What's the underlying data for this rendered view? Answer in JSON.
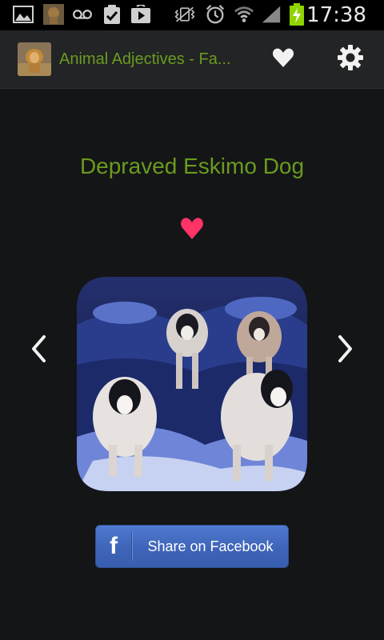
{
  "status_bar": {
    "time": "17:38",
    "icons": [
      "image-icon",
      "animal-thumbnail-icon",
      "voicemail-icon",
      "clipboard-check-icon",
      "play-store-icon",
      "vibrate-icon",
      "alarm-icon",
      "wifi-icon",
      "signal-icon",
      "battery-charging-icon"
    ]
  },
  "action_bar": {
    "title": "Animal Adjectives - Fa...",
    "icons": [
      "app-icon",
      "heart-icon",
      "gear-icon"
    ]
  },
  "main": {
    "animal_name": "Depraved Eskimo Dog",
    "heart_color": "#ff3366",
    "prev_icon": "chevron-left-icon",
    "next_icon": "chevron-right-icon"
  },
  "share": {
    "facebook_label": "Share on Facebook",
    "facebook_logo": "f",
    "color": "#3e64b9"
  },
  "colors": {
    "title_green": "#6a9b1f",
    "background": "#141516",
    "action_bar": "#222426"
  }
}
